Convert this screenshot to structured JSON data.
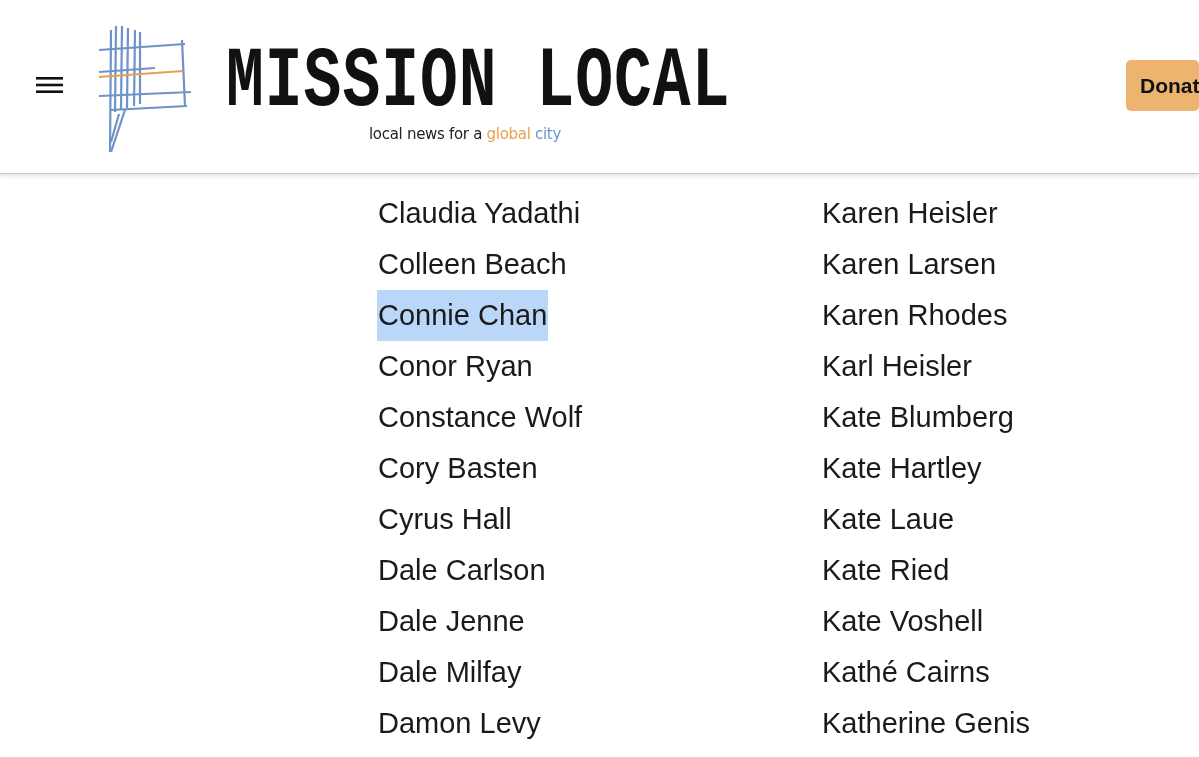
{
  "header": {
    "title": "MISSION LOCAL",
    "tagline": [
      {
        "text": "local news for a ",
        "color": "#222222"
      },
      {
        "text": "global",
        "color": "#e9a04a"
      },
      {
        "text": " city",
        "color": "#6f93c6"
      }
    ],
    "donate_button": "Donat"
  },
  "columns": [
    [
      {
        "name": "Claudia Yadathi",
        "selected": false
      },
      {
        "name": "Colleen Beach",
        "selected": false
      },
      {
        "name": "Connie Chan",
        "selected": true
      },
      {
        "name": "Conor Ryan",
        "selected": false
      },
      {
        "name": "Constance Wolf",
        "selected": false
      },
      {
        "name": "Cory Basten",
        "selected": false
      },
      {
        "name": "Cyrus Hall",
        "selected": false
      },
      {
        "name": "Dale Carlson",
        "selected": false
      },
      {
        "name": "Dale Jenne",
        "selected": false
      },
      {
        "name": "Dale Milfay",
        "selected": false
      },
      {
        "name": "Damon Levy",
        "selected": false
      }
    ],
    [
      {
        "name": "Karen Heisler",
        "selected": false
      },
      {
        "name": "Karen Larsen",
        "selected": false
      },
      {
        "name": "Karen Rhodes",
        "selected": false
      },
      {
        "name": "Karl Heisler",
        "selected": false
      },
      {
        "name": "Kate Blumberg",
        "selected": false
      },
      {
        "name": "Kate Hartley",
        "selected": false
      },
      {
        "name": "Kate Laue",
        "selected": false
      },
      {
        "name": "Kate Ried",
        "selected": false
      },
      {
        "name": "Kate Voshell",
        "selected": false
      },
      {
        "name": "Kathé Cairns",
        "selected": false
      },
      {
        "name": "Katherine Genis",
        "selected": false
      }
    ]
  ]
}
